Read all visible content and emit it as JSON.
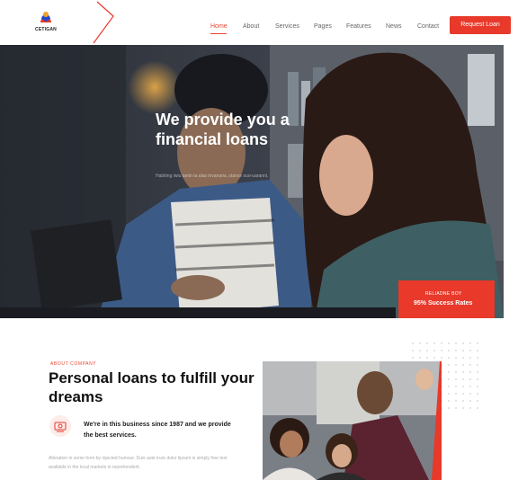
{
  "brand": {
    "name": "CETIGAN"
  },
  "nav": {
    "items": [
      {
        "label": "Home",
        "active": true
      },
      {
        "label": "About"
      },
      {
        "label": "Services"
      },
      {
        "label": "Pages"
      },
      {
        "label": "Features"
      },
      {
        "label": "News"
      },
      {
        "label": "Contact"
      }
    ],
    "cta": "Request Loan"
  },
  "hero": {
    "title": "We provide you a financial loans",
    "subtitle": "Habiting iwiu tantn ta alas invanaria, stance suo-uaranni.",
    "success": {
      "small": "RELIADNE BOY",
      "big": "95% Success Rates"
    }
  },
  "about": {
    "tag": "ABOUT COMPANY",
    "title": "Personal loans to fulfill your dreams",
    "feature_text": "We're in this business since 1987 and we provide the best services.",
    "paragraph": "Alteration in some form by injected humour. Duis aute irure dolor lipsum is simply free text available in the local markets in reprehenderit."
  },
  "colors": {
    "accent": "#e8392a",
    "dark": "#1b1b1b"
  },
  "icons": [
    "logo-icon",
    "chevron-icon",
    "money-icon"
  ]
}
